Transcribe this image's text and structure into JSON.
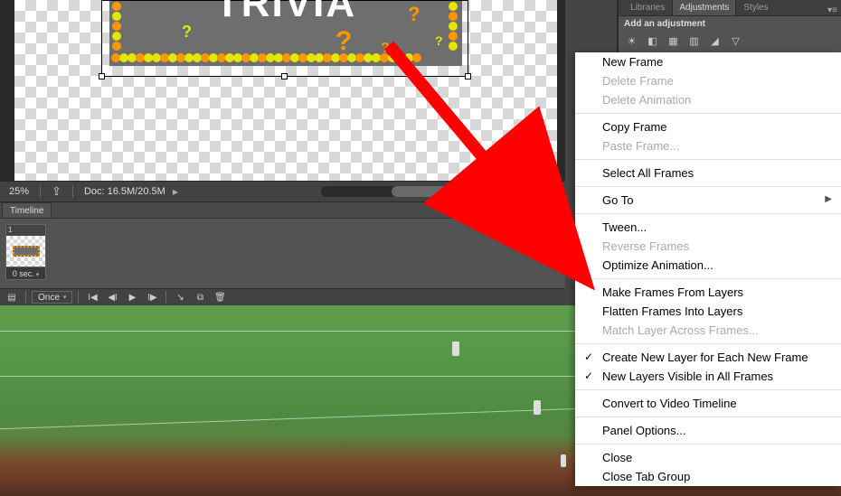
{
  "main": {
    "artwork_text": "TRIVIA",
    "zoom": "25%",
    "doc_info": "Doc: 16.5M/20.5M"
  },
  "timeline": {
    "tab_label": "Timeline",
    "frames": [
      {
        "number": "1",
        "delay": "0 sec."
      }
    ],
    "loop_mode": "Once"
  },
  "right_panel": {
    "tabs": {
      "libraries": "Libraries",
      "adjustments": "Adjustments",
      "styles": "Styles"
    },
    "add_label": "Add an adjustment",
    "icons": [
      "☀",
      "◧",
      "▦",
      "▥",
      "◢",
      "▽"
    ]
  },
  "menu": {
    "items": [
      {
        "id": "new_frame",
        "label": "New Frame",
        "enabled": true
      },
      {
        "id": "delete_frame",
        "label": "Delete Frame",
        "enabled": false
      },
      {
        "id": "delete_animation",
        "label": "Delete Animation",
        "enabled": false
      },
      {
        "sep": true
      },
      {
        "id": "copy_frame",
        "label": "Copy Frame",
        "enabled": true
      },
      {
        "id": "paste_frame",
        "label": "Paste Frame...",
        "enabled": false
      },
      {
        "sep": true
      },
      {
        "id": "select_all",
        "label": "Select All Frames",
        "enabled": true
      },
      {
        "sep": true
      },
      {
        "id": "go_to",
        "label": "Go To",
        "enabled": true,
        "submenu": true
      },
      {
        "sep": true
      },
      {
        "id": "tween",
        "label": "Tween...",
        "enabled": true
      },
      {
        "id": "reverse_frames",
        "label": "Reverse Frames",
        "enabled": false
      },
      {
        "id": "optimize",
        "label": "Optimize Animation...",
        "enabled": true
      },
      {
        "sep": true
      },
      {
        "id": "make_from_layers",
        "label": "Make Frames From Layers",
        "enabled": true
      },
      {
        "id": "flatten_into_layers",
        "label": "Flatten Frames Into Layers",
        "enabled": true
      },
      {
        "id": "match_layer",
        "label": "Match Layer Across Frames...",
        "enabled": false
      },
      {
        "sep": true
      },
      {
        "id": "new_layer_each",
        "label": "Create New Layer for Each New Frame",
        "enabled": true,
        "checked": true
      },
      {
        "id": "visible_all",
        "label": "New Layers Visible in All Frames",
        "enabled": true,
        "checked": true
      },
      {
        "sep": true
      },
      {
        "id": "convert_video",
        "label": "Convert to Video Timeline",
        "enabled": true
      },
      {
        "sep": true
      },
      {
        "id": "panel_options",
        "label": "Panel Options...",
        "enabled": true
      },
      {
        "sep": true
      },
      {
        "id": "close",
        "label": "Close",
        "enabled": true
      },
      {
        "id": "close_tab_group",
        "label": "Close Tab Group",
        "enabled": true
      }
    ]
  }
}
